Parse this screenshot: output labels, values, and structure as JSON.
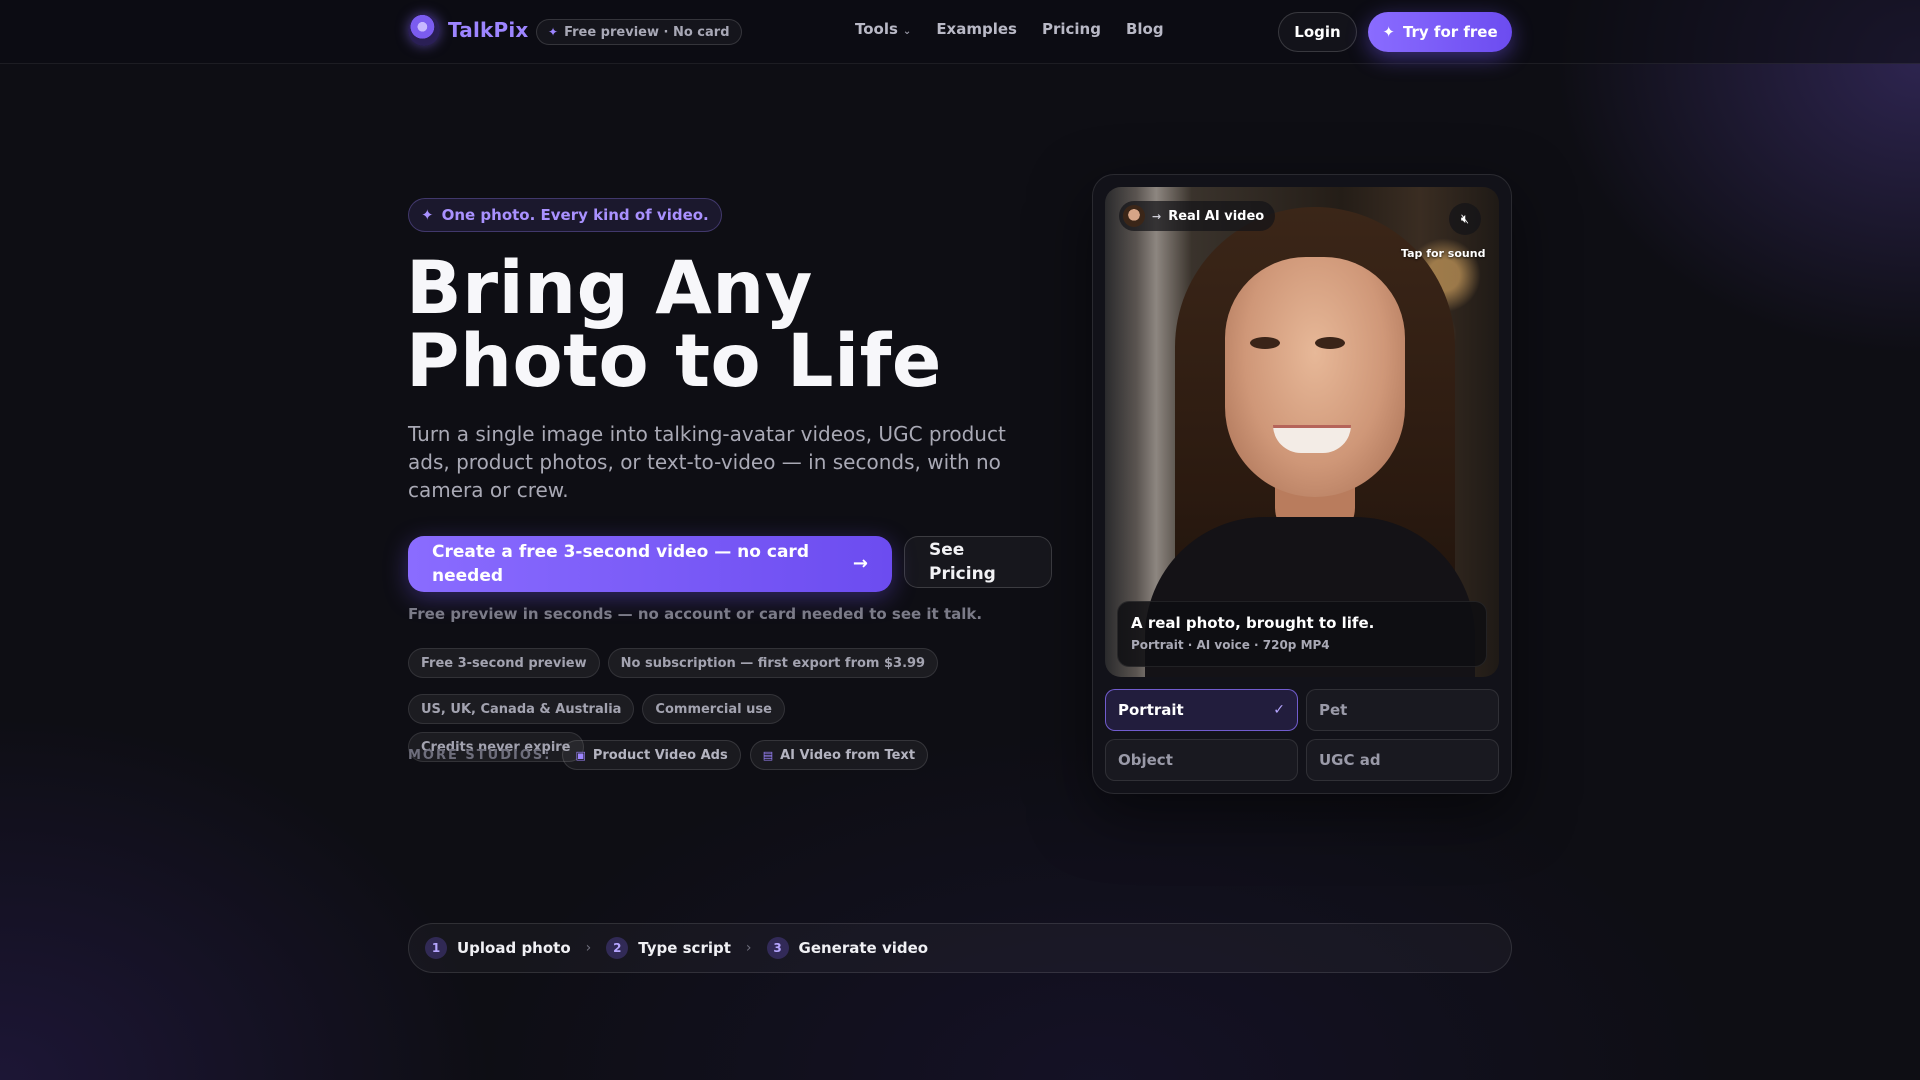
{
  "nav": {
    "brand": "TalkPix",
    "pill": "Free preview · No card",
    "links": [
      "Tools",
      "Examples",
      "Pricing",
      "Blog"
    ],
    "login": "Login",
    "try_free": "Try for free"
  },
  "hero": {
    "badge": "One photo. Every kind of video.",
    "title_line1": "Bring Any",
    "title_line2": "Photo to Life",
    "subtitle": "Turn a single image into talking-avatar videos, UGC product ads, product photos, or text-to-video — in seconds, with no camera or crew.",
    "cta_primary": "Create a free 3-second video — no card needed",
    "cta_secondary": "See Pricing",
    "note": "Free preview in seconds — no account or card needed to see it talk.",
    "chips_row1": [
      "Free 3-second preview",
      "No subscription — first export from $3.99"
    ],
    "chips_row2": [
      "US, UK, Canada & Australia",
      "Commercial use",
      "Credits never expire"
    ],
    "studios_label": "MORE STUDIOS:",
    "studios": [
      "Product Video Ads",
      "AI Video from Text"
    ]
  },
  "demo": {
    "tag": "Real AI video",
    "tap_for_sound": "Tap for sound",
    "caption_title": "A real photo, brought to life.",
    "caption_meta": "Portrait · AI voice · 720p MP4",
    "options": [
      "Portrait",
      "Pet",
      "Object",
      "UGC ad"
    ],
    "selected_option": "Portrait"
  },
  "steps": [
    {
      "num": "1",
      "label": "Upload photo"
    },
    {
      "num": "2",
      "label": "Type script"
    },
    {
      "num": "3",
      "label": "Generate video"
    }
  ],
  "colors": {
    "accent": "#8a6cff",
    "background": "#0e0e14"
  },
  "icons": {
    "sparkle": "sparkle-icon",
    "chevron": "chevron-down-icon",
    "arrow": "arrow-right-icon",
    "mute": "speaker-muted-icon",
    "check": "check-icon"
  }
}
